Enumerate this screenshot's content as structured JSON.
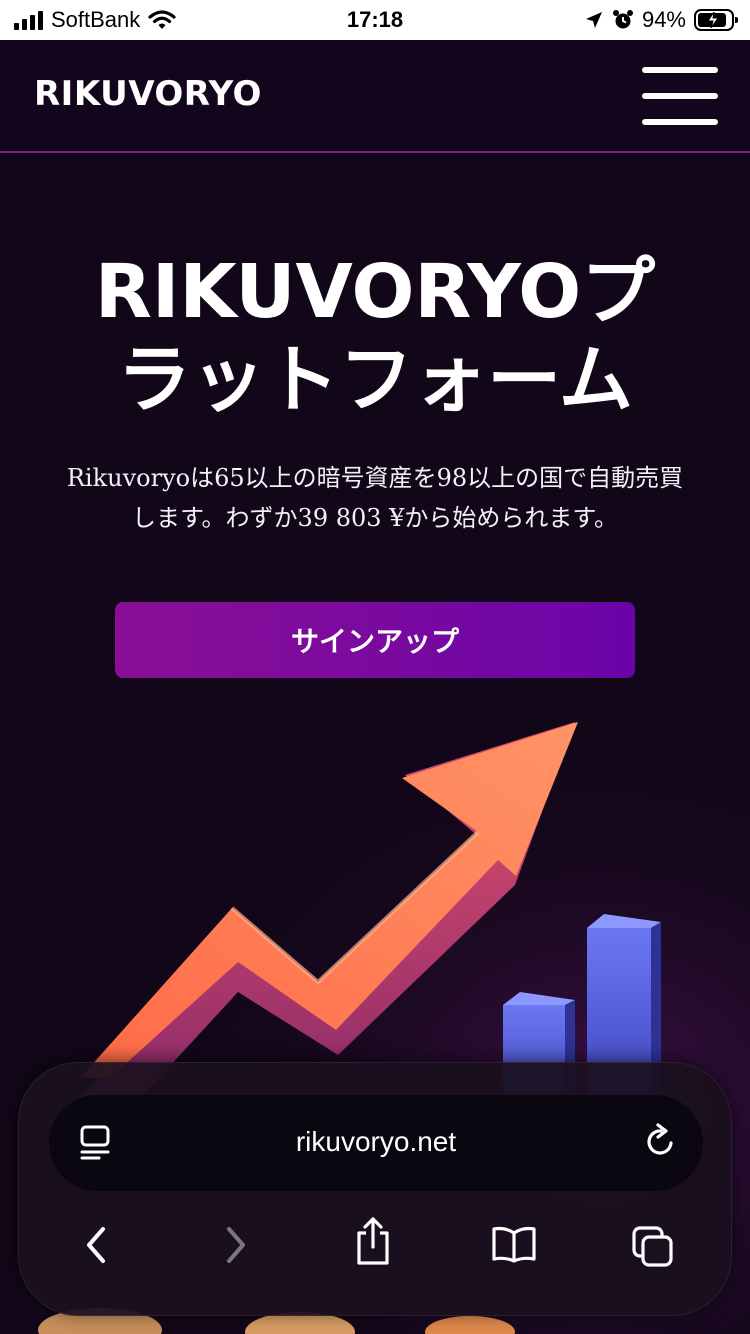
{
  "status_bar": {
    "carrier": "SoftBank",
    "time": "17:18",
    "battery": "94%"
  },
  "header": {
    "logo": "RIKUVORYO"
  },
  "hero": {
    "title_line1": "RIKUVORYOプ",
    "title_line2": "ラットフォーム",
    "description_line1": "Rikuvoryoは65以上の暗号資産を98以上の国で自動売買",
    "description_line2": "します。わずか39 803 ¥から始められます。",
    "signup_label": "サインアップ"
  },
  "browser": {
    "url": "rikuvoryo.net"
  },
  "colors": {
    "background": "#120718",
    "header_border": "#7a1f8c",
    "button_start": "#8a0f95",
    "button_end": "#6a04a8",
    "arrow": "#ff7a50",
    "bars": "#5a66e0"
  },
  "icons": {
    "signal": "signal-icon",
    "wifi": "wifi-icon",
    "location": "location-arrow-icon",
    "alarm": "alarm-clock-icon",
    "battery": "battery-charging-icon",
    "menu": "hamburger-menu-icon",
    "reader": "reader-mode-icon",
    "reload": "reload-icon",
    "back": "chevron-left-icon",
    "forward": "chevron-right-icon",
    "share": "share-icon",
    "bookmarks": "book-icon",
    "tabs": "tabs-icon"
  }
}
